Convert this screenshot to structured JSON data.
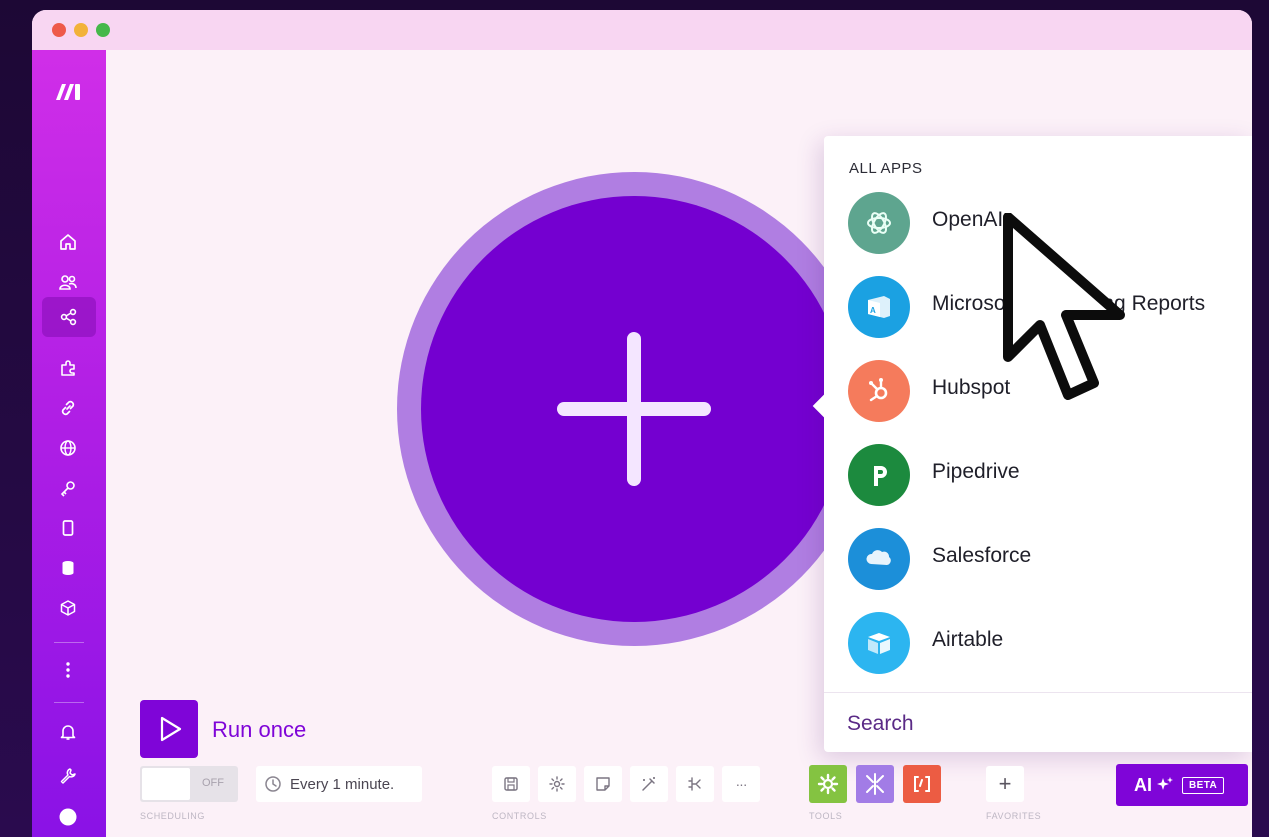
{
  "app": {
    "name": "Make",
    "logo_text": "/m"
  },
  "colors": {
    "brand_purple": "#7f05d8",
    "module_outer": "#b07ee2",
    "module_inner": "#7400d0",
    "sidebar_top": "#d02ee8",
    "sidebar_bottom": "#8a12e6"
  },
  "sidebar": {
    "items": [
      {
        "icon": "home-icon"
      },
      {
        "icon": "team-icon"
      },
      {
        "icon": "scenarios-icon",
        "active": true
      },
      {
        "icon": "apps-puzzle-icon"
      },
      {
        "icon": "connections-link-icon"
      },
      {
        "icon": "webhooks-globe-icon"
      },
      {
        "icon": "keys-icon"
      },
      {
        "icon": "devices-icon"
      },
      {
        "icon": "data-stores-icon"
      },
      {
        "icon": "data-structures-icon"
      },
      {
        "icon": "more-icon"
      },
      {
        "icon": "notifications-bell-icon"
      },
      {
        "icon": "resources-wrench-icon"
      },
      {
        "icon": "profile-avatar-icon"
      }
    ]
  },
  "app_panel": {
    "heading": "ALL APPS",
    "apps": [
      {
        "name": "OpenAI",
        "icon": "openai-logo-icon",
        "color": "#5ea58f"
      },
      {
        "name": "Microsoft Advertising Reports",
        "icon": "microsoft-advertising-logo-icon",
        "color": "#1ba1e2"
      },
      {
        "name": "Hubspot",
        "icon": "hubspot-logo-icon",
        "color": "#f57b5c"
      },
      {
        "name": "Pipedrive",
        "icon": "pipedrive-logo-icon",
        "color": "#1c8a3e"
      },
      {
        "name": "Salesforce",
        "icon": "salesforce-logo-icon",
        "color": "#1c8fd9"
      },
      {
        "name": "Airtable",
        "icon": "airtable-logo-icon",
        "color": "#2cb5f0"
      }
    ],
    "search_label": "Search"
  },
  "bottom_bar": {
    "run_once_label": "Run once",
    "scheduling": {
      "toggle_state": "OFF",
      "interval_text": "Every 1 minute.",
      "section_label": "SCHEDULING"
    },
    "controls": {
      "section_label": "CONTROLS",
      "buttons": [
        "save-icon",
        "settings-icon",
        "notes-icon",
        "auto-align-icon",
        "explain-flow-icon",
        "more-icon"
      ],
      "more_text": "···"
    },
    "tools": {
      "section_label": "TOOLS",
      "buttons": [
        {
          "icon": "tools-gear-icon",
          "color": "#84c341"
        },
        {
          "icon": "flow-control-icon",
          "color": "#a27ce6"
        },
        {
          "icon": "text-parser-icon",
          "color": "#ec5c43"
        }
      ]
    },
    "favorites": {
      "section_label": "FAVORITES",
      "add_text": "+"
    },
    "ai": {
      "label": "AI",
      "badge": "BETA"
    }
  }
}
